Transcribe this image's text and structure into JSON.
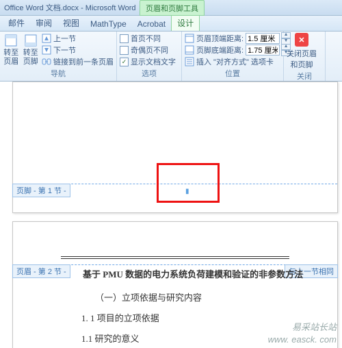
{
  "title": "Office Word 文档.docx - Microsoft Word",
  "context_tab": "页眉和页脚工具",
  "tabs": [
    "邮件",
    "审阅",
    "视图",
    "MathType",
    "Acrobat",
    "设计"
  ],
  "active_tab_index": 5,
  "ribbon": {
    "goto": {
      "header": "转至页眉",
      "footer": "转至页脚"
    },
    "nav": {
      "prev": "上一节",
      "next": "下一节",
      "link": "链接到前一条页眉",
      "label": "导航"
    },
    "options": {
      "diff_first": "首页不同",
      "diff_odd_even": "奇偶页不同",
      "show_doc_text": "显示文档文字",
      "label": "选项"
    },
    "position": {
      "header_dist": "页眉顶端距离:",
      "footer_dist": "页脚底端距离:",
      "hval": "1.5 厘米",
      "fval": "1.75 厘米",
      "align_tab": "插入 \"对齐方式\" 选项卡",
      "label": "位置"
    },
    "close": {
      "btn": "关闭页眉\n和页脚",
      "label": "关闭"
    }
  },
  "page1": {
    "footer_tag": "页脚 - 第 1 节 -"
  },
  "page2": {
    "header_tag": "页眉 - 第 2 节 -",
    "link_prev": "与上一节相同",
    "title": "基于 PMU 数据的电力系统负荷建模和验证的非参数方法",
    "sec1": "（一）立项依据与研究内容",
    "sec1_1": "1. 1 项目的立项依据",
    "sec1_1_1": "1.1 研究的意义"
  },
  "watermark": {
    "line1": "易采站长站",
    "line2": "www. easck. com"
  }
}
